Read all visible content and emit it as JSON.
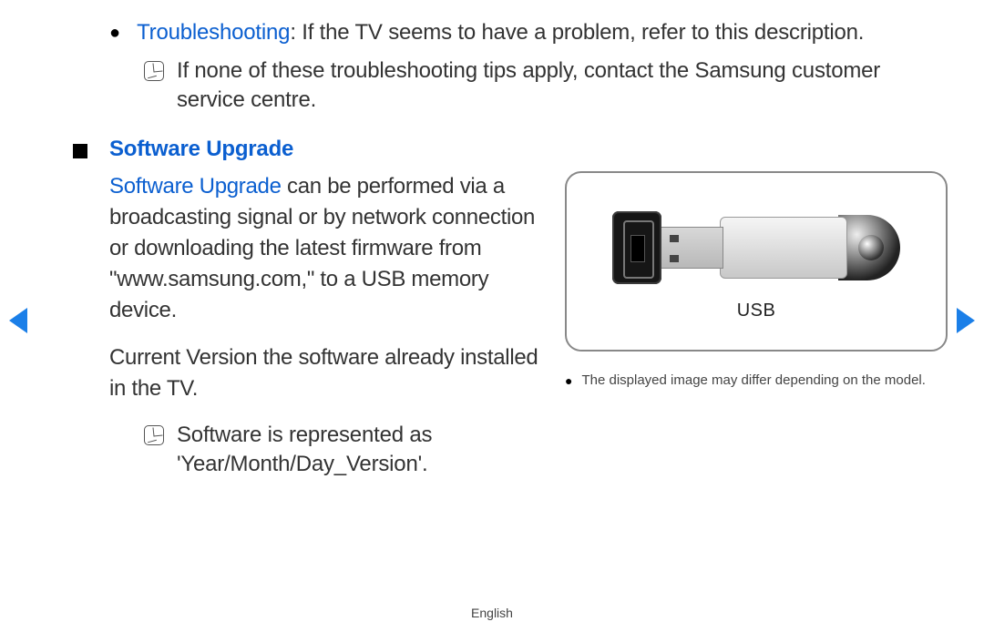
{
  "troubleshooting": {
    "label": "Troubleshooting",
    "desc": ": If the TV seems to have a problem, refer to this description.",
    "note": "If none of these troubleshooting tips apply, contact the Samsung customer service centre."
  },
  "software_upgrade": {
    "heading": "Software Upgrade",
    "lead_bold": "Software Upgrade",
    "lead_rest": " can be performed via a broadcasting signal or by network connection or downloading the latest firmware from \"www.samsung.com,\" to a USB memory device.",
    "current": "Current Version the software already installed in the TV.",
    "format_note": "Software is represented as 'Year/Month/Day_Version'."
  },
  "usb": {
    "label": "USB",
    "caption": "The displayed image may differ depending on the model."
  },
  "footer": "English"
}
